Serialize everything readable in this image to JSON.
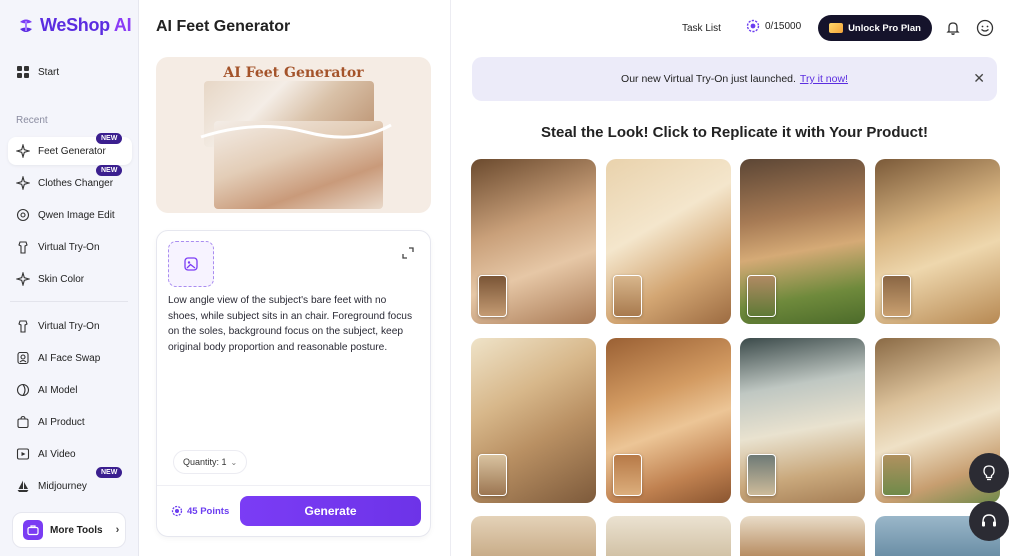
{
  "brand": {
    "name_main": "WeShop",
    "name_ai": " AI",
    "accent": "#6b3df0"
  },
  "sidebar": {
    "start_label": "Start",
    "recent_label": "Recent",
    "recent_items": [
      {
        "label": "Feet Generator",
        "badge": "NEW",
        "icon": "sparkle-icon"
      },
      {
        "label": "Clothes Changer",
        "badge": "NEW",
        "icon": "sparkle-icon"
      },
      {
        "label": "Qwen Image Edit",
        "badge": "",
        "icon": "swirl-icon"
      },
      {
        "label": "Virtual Try-On",
        "badge": "",
        "icon": "hanger-icon"
      },
      {
        "label": "Skin Color",
        "badge": "",
        "icon": "sparkle-icon"
      }
    ],
    "tool_items": [
      {
        "label": "Virtual Try-On",
        "badge": "",
        "icon": "hanger-icon"
      },
      {
        "label": "AI Face Swap",
        "badge": "",
        "icon": "face-icon"
      },
      {
        "label": "AI Model",
        "badge": "",
        "icon": "swirl-icon"
      },
      {
        "label": "AI Product",
        "badge": "",
        "icon": "product-icon"
      },
      {
        "label": "AI Video",
        "badge": "",
        "icon": "video-icon"
      },
      {
        "label": "Midjourney",
        "badge": "NEW",
        "icon": "ship-icon"
      }
    ],
    "more_tools_label": "More Tools"
  },
  "panel": {
    "title": "AI Feet Generator",
    "hero_title": "AI Feet Generator",
    "prompt": "Low angle view of the subject's bare feet with no shoes, while subject sits in an chair. Foreground focus on the soles, background focus on the subject, keep original body proportion and reasonable posture.",
    "quantity_label": "Quantity: 1",
    "points_label": "45 Points",
    "generate_label": "Generate"
  },
  "topbar": {
    "task_list": "Task List",
    "credits": "0/15000",
    "pro_label": "Unlock Pro Plan"
  },
  "banner": {
    "text": "Our new Virtual Try-On just launched.",
    "link": "Try it now!"
  },
  "gallery": {
    "title": "Steal the Look! Click to Replicate it with Your Product!"
  }
}
